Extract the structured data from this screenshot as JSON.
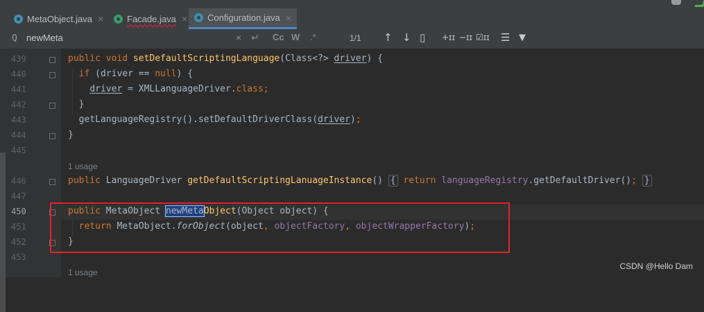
{
  "tabs": [
    {
      "label": "MetaObject.java",
      "close": "×"
    },
    {
      "label": "Facade.java",
      "close": "×"
    },
    {
      "label": "Configuration.java",
      "close": "×"
    }
  ],
  "search": {
    "value": "newMeta",
    "search_icon": "Q",
    "clear": "×",
    "newline": "↵",
    "match_case": "Cc",
    "words": "W",
    "regex": ".*",
    "match_count": "1/1",
    "prev": "↑",
    "next": "↓",
    "select_all": "▯",
    "add_selection": "+ɪɪ",
    "remove_selection": "−ɪɪ",
    "exclude": "☑ɪɪ",
    "options": "☰",
    "filter": "▼"
  },
  "lines": [
    {
      "num": "439",
      "parts": [
        [
          "kw",
          "public void "
        ],
        [
          "fn",
          "setDefaultScriptingLanguage"
        ],
        [
          "",
          "(Class<?> "
        ],
        [
          "ul",
          "driver"
        ],
        [
          "",
          ") {"
        ]
      ]
    },
    {
      "num": "440",
      "indent": 1,
      "parts": [
        [
          "kw",
          "if "
        ],
        [
          "",
          "(driver == "
        ],
        [
          "kw",
          "null"
        ],
        [
          "",
          ") {"
        ]
      ]
    },
    {
      "num": "441",
      "indent": 2,
      "parts": [
        [
          "ul",
          "driver"
        ],
        [
          "",
          " = XMLLanguageDriver."
        ],
        [
          "kw",
          "class"
        ],
        [
          "kw",
          ";"
        ]
      ]
    },
    {
      "num": "442",
      "indent": 1,
      "parts": [
        [
          "",
          "}"
        ]
      ]
    },
    {
      "num": "443",
      "indent": 1,
      "parts": [
        [
          "",
          "getLanguageRegistry().setDefaultDriverClass("
        ],
        [
          "ul",
          "driver"
        ],
        [
          "",
          ")"
        ],
        [
          "kw",
          ";"
        ]
      ]
    },
    {
      "num": "444",
      "parts": [
        [
          "",
          "}"
        ]
      ]
    },
    {
      "num": "445",
      "parts": []
    },
    {
      "num": "446",
      "parts": [
        [
          "kw",
          "public "
        ],
        [
          "",
          "LanguageDriver "
        ],
        [
          "fn",
          "getDefaultScriptingLanuageInstance"
        ],
        [
          "",
          "() "
        ],
        [
          "fb",
          "{"
        ],
        [
          "kw",
          " return "
        ],
        [
          "fld",
          "languageRegistry"
        ],
        [
          "",
          ".getDefaultDriver()"
        ],
        [
          "kw",
          ";"
        ],
        [
          "",
          " "
        ],
        [
          "fb",
          "}"
        ]
      ]
    },
    {
      "num": "447",
      "parts": []
    },
    {
      "num": "450",
      "parts": [
        [
          "kw",
          "public "
        ],
        [
          "",
          "MetaObject "
        ],
        [
          "hl",
          "newMeta"
        ],
        [
          "fn",
          "Object"
        ],
        [
          "",
          "(Object object) {"
        ]
      ]
    },
    {
      "num": "451",
      "indent": 1,
      "parts": [
        [
          "kw",
          "return "
        ],
        [
          "",
          "MetaObject."
        ],
        [
          "it",
          "forObject"
        ],
        [
          "",
          "(object"
        ],
        [
          "kw",
          ", "
        ],
        [
          "fld",
          "objectFactory"
        ],
        [
          "kw",
          ", "
        ],
        [
          "fld",
          "objectWrapperFactory"
        ],
        [
          "",
          ")"
        ],
        [
          "kw",
          ";"
        ]
      ]
    },
    {
      "num": "452",
      "parts": [
        [
          "",
          "}"
        ]
      ]
    },
    {
      "num": "453",
      "parts": []
    }
  ],
  "usage_labels": [
    "1 usage",
    "1 usage"
  ],
  "watermark": "CSDN @Hello Dam",
  "colors": {
    "keyword": "#cc7832",
    "method": "#ffc66d",
    "field": "#9876aa",
    "text": "#a9b7c6",
    "highlight_box": "#e0242b"
  }
}
